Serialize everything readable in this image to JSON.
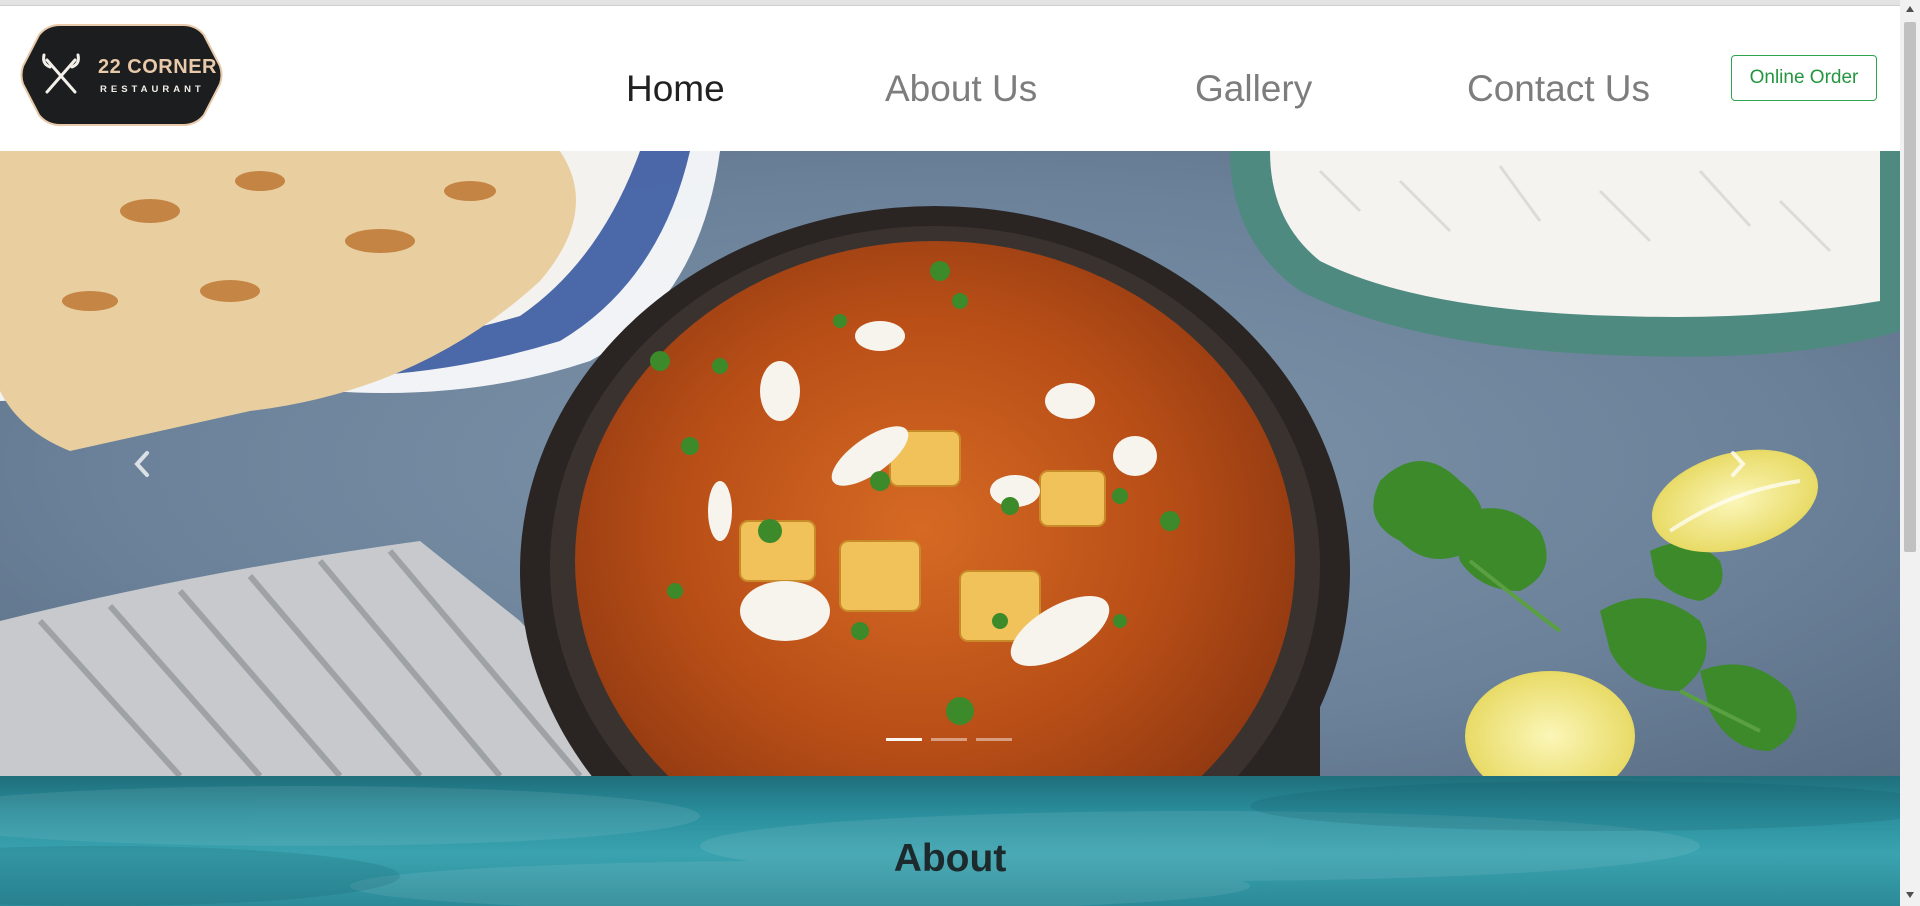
{
  "brand": {
    "logo_line1": "22 CORNER",
    "logo_line2": "RESTAURANT",
    "logo_bg_color": "#1c1d1f",
    "logo_accent_color": "#e8c9a9"
  },
  "nav": {
    "links": [
      {
        "label": "Home",
        "active": true
      },
      {
        "label": "About Us",
        "active": false
      },
      {
        "label": "Gallery",
        "active": false
      },
      {
        "label": "Contact Us",
        "active": false
      }
    ],
    "order_button": "Online Order",
    "accent_color": "#2ea44f"
  },
  "hero": {
    "image_description": "paneer-butter-masala-in-skillet-with-paratha-rice-lemon-herbs",
    "prev_icon": "chevron-left-icon",
    "next_icon": "chevron-right-icon",
    "slide_count": 3,
    "active_slide": 1
  },
  "about": {
    "heading": "About"
  }
}
